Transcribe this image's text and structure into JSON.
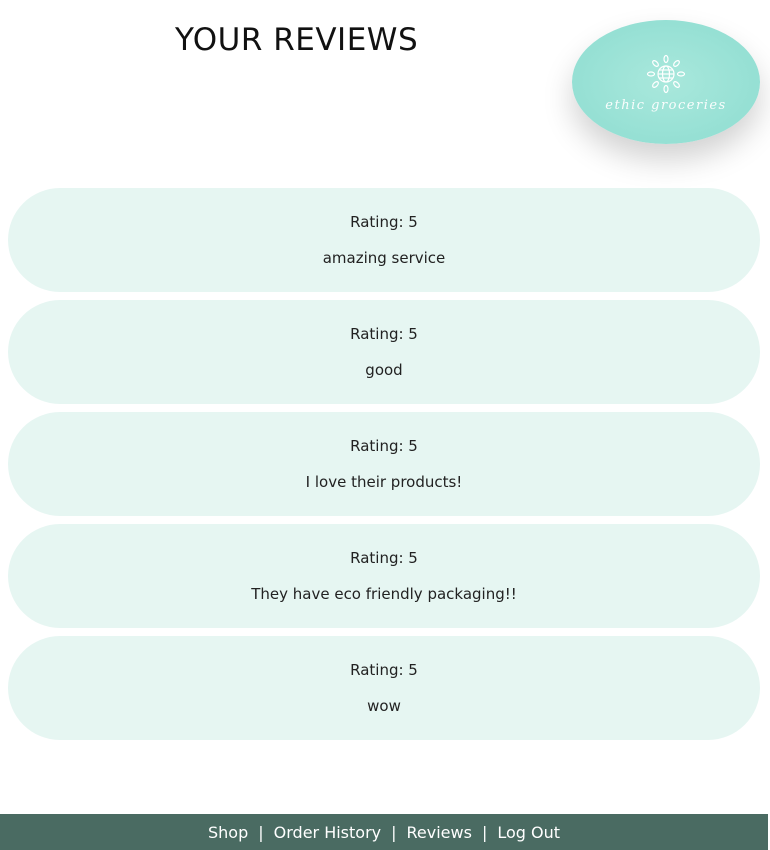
{
  "header": {
    "title": "YOUR REVIEWS"
  },
  "logo": {
    "text": "ethic groceries",
    "icon": "globe-flower-icon"
  },
  "reviews": [
    {
      "rating": "Rating: 5",
      "text": "amazing service"
    },
    {
      "rating": "Rating: 5",
      "text": "good"
    },
    {
      "rating": "Rating: 5",
      "text": "I love their products!"
    },
    {
      "rating": "Rating: 5",
      "text": "They have eco friendly packaging!!"
    },
    {
      "rating": "Rating: 5",
      "text": "wow"
    }
  ],
  "footer": {
    "links": [
      "Shop",
      "Order History",
      "Reviews",
      "Log Out"
    ],
    "separator": "|"
  },
  "colors": {
    "card_bg": "#e6f6f2",
    "logo_bg": "#98e1d5",
    "footer_bg": "#4a6b62"
  }
}
